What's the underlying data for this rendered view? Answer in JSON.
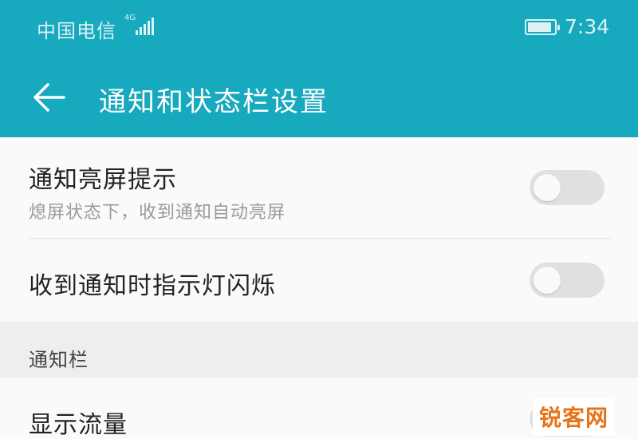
{
  "status_bar": {
    "carrier": "中国电信",
    "network": "4G",
    "time": "7:34",
    "battery_level": 0.9
  },
  "app_bar": {
    "title": "通知和状态栏设置",
    "back_icon": "arrow-left-icon"
  },
  "settings": [
    {
      "title": "通知亮屏提示",
      "subtitle": "熄屏状态下，收到通知自动亮屏",
      "enabled": false
    },
    {
      "title": "收到通知时指示灯闪烁",
      "enabled": false
    }
  ],
  "section": {
    "label": "通知栏",
    "items": [
      {
        "title": "显示流量",
        "enabled": false
      }
    ]
  },
  "watermark": "锐客网",
  "colors": {
    "primary": "#17a9bd",
    "background": "#fafafa",
    "section_background": "#eeeeee",
    "switch_off_track": "#e0e0e0",
    "watermark": "#e8741a"
  }
}
